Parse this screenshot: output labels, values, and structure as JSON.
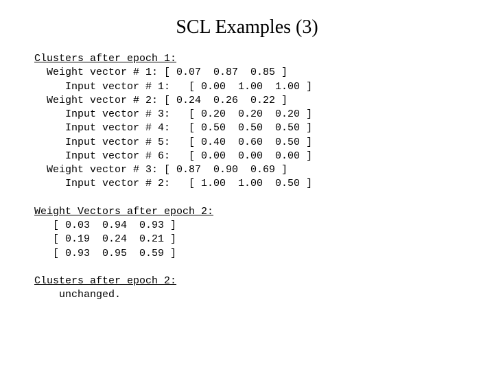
{
  "title": "SCL Examples (3)",
  "section1_header": "Clusters after epoch 1:",
  "section1_lines": [
    "  Weight vector # 1: [ 0.07  0.87  0.85 ]",
    "     Input vector # 1:   [ 0.00  1.00  1.00 ]",
    "  Weight vector # 2: [ 0.24  0.26  0.22 ]",
    "     Input vector # 3:   [ 0.20  0.20  0.20 ]",
    "     Input vector # 4:   [ 0.50  0.50  0.50 ]",
    "     Input vector # 5:   [ 0.40  0.60  0.50 ]",
    "     Input vector # 6:   [ 0.00  0.00  0.00 ]",
    "  Weight vector # 3: [ 0.87  0.90  0.69 ]",
    "     Input vector # 2:   [ 1.00  1.00  0.50 ]"
  ],
  "section2_header": "Weight Vectors after epoch 2:",
  "section2_lines": [
    "   [ 0.03  0.94  0.93 ]",
    "   [ 0.19  0.24  0.21 ]",
    "   [ 0.93  0.95  0.59 ]"
  ],
  "section3_header": "Clusters after epoch 2:",
  "section3_lines": [
    "    unchanged."
  ]
}
